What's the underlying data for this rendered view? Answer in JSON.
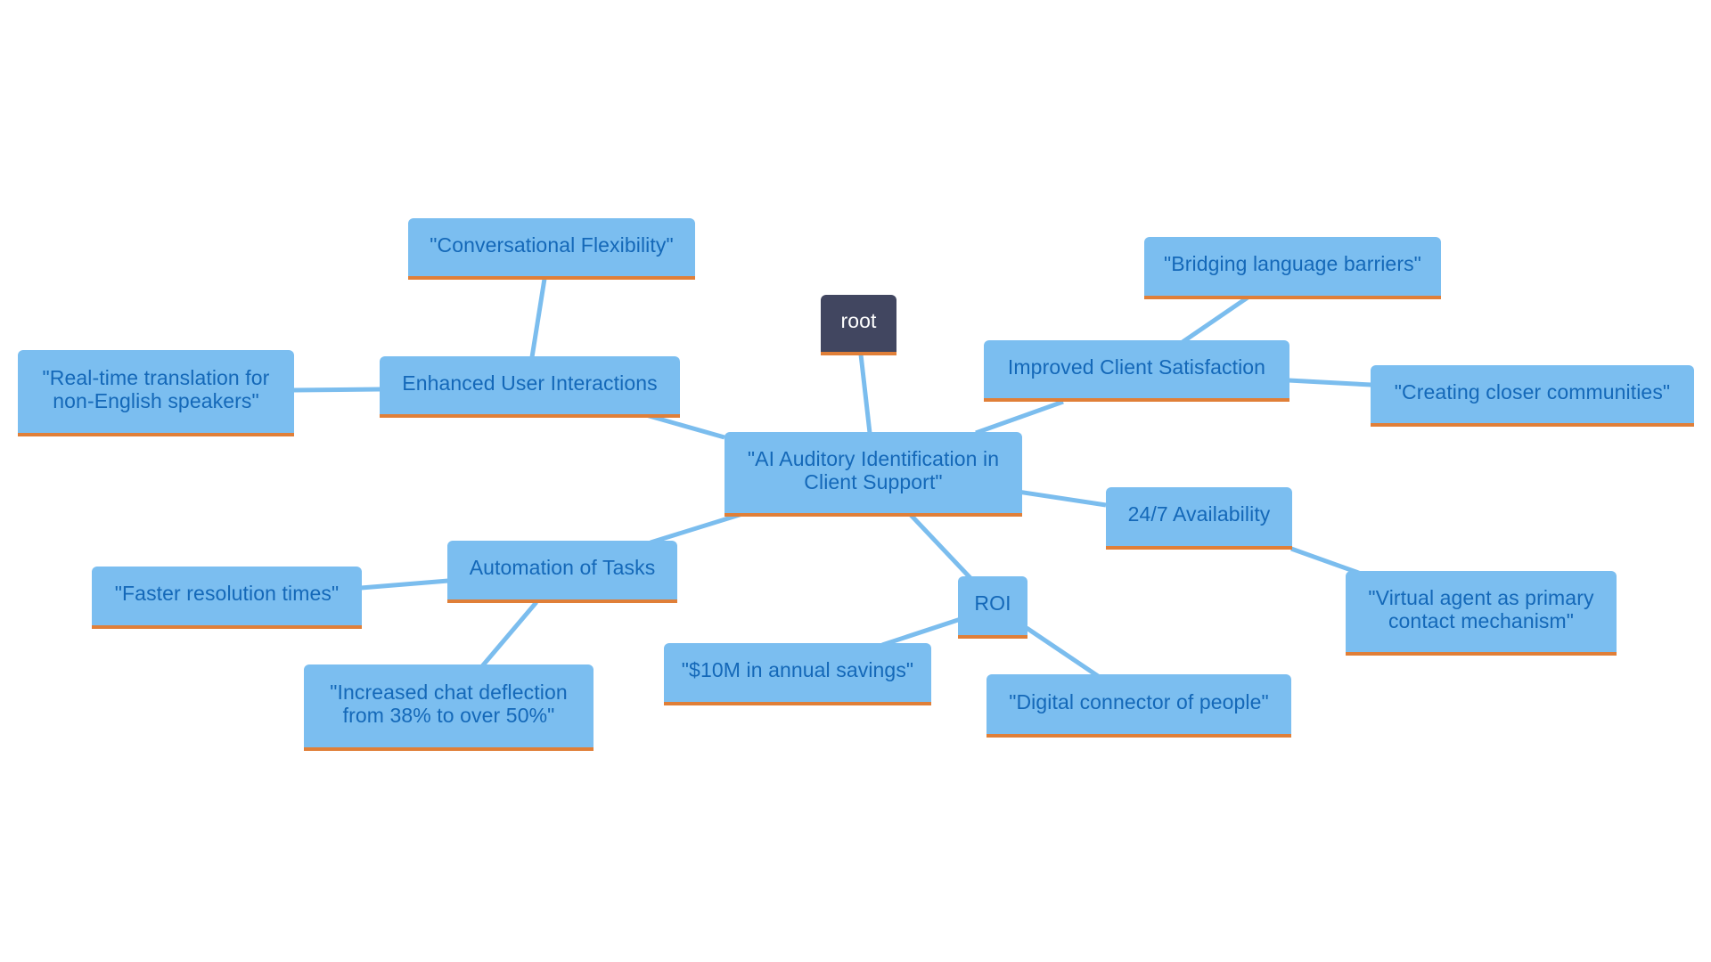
{
  "diagram": {
    "type": "mindmap",
    "colors": {
      "node_fill": "#7bbef0",
      "node_text": "#1468b8",
      "node_accent_border": "#e07f38",
      "root_fill": "#414660",
      "root_text": "#ffffff",
      "edge": "#7bbdee"
    },
    "nodes": {
      "root": {
        "label": "root",
        "parent": null
      },
      "center": {
        "label": "\"AI Auditory Identification in Client Support\"",
        "parent": "root"
      },
      "enhanced": {
        "label": "Enhanced User Interactions",
        "parent": "center"
      },
      "conversational": {
        "label": "\"Conversational Flexibility\"",
        "parent": "enhanced"
      },
      "translation": {
        "label": "\"Real-time translation for non-English speakers\"",
        "parent": "enhanced"
      },
      "automation": {
        "label": "Automation of Tasks",
        "parent": "center"
      },
      "faster": {
        "label": "\"Faster resolution times\"",
        "parent": "automation"
      },
      "deflection": {
        "label": "\"Increased chat deflection from 38% to over 50%\"",
        "parent": "automation"
      },
      "roi": {
        "label": "ROI",
        "parent": "center"
      },
      "savings": {
        "label": "\"$10M in annual savings\"",
        "parent": "roi"
      },
      "connector": {
        "label": "\"Digital connector of people\"",
        "parent": "roi"
      },
      "improved": {
        "label": "Improved Client Satisfaction",
        "parent": "center"
      },
      "bridging": {
        "label": "\"Bridging language barriers\"",
        "parent": "improved"
      },
      "communities": {
        "label": "\"Creating closer communities\"",
        "parent": "improved"
      },
      "availability": {
        "label": "24/7 Availability",
        "parent": "center"
      },
      "virtual": {
        "label": "\"Virtual agent as primary contact mechanism\"",
        "parent": "availability"
      }
    }
  }
}
